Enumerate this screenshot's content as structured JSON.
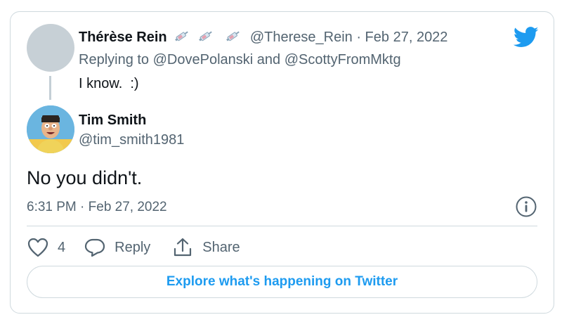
{
  "parent_tweet": {
    "author_name": "Thérèse Rein",
    "emojis": [
      "syringe-emoji",
      "syringe-emoji",
      "syringe-emoji"
    ],
    "handle_time": "@Therese_Rein · Feb 27, 2022",
    "replying_prefix": "Replying to",
    "replying_to_1": "@DovePolanski",
    "replying_and": "and",
    "replying_to_2": "@ScottyFromMktg",
    "text": "I know.  :)"
  },
  "main_tweet": {
    "author_name": "Tim Smith",
    "handle": "@tim_smith1981",
    "text": "No you didn't.",
    "timestamp": "6:31 PM · Feb 27, 2022"
  },
  "actions": {
    "like_count": "4",
    "reply_label": "Reply",
    "share_label": "Share"
  },
  "explore_button": "Explore what's happening on Twitter",
  "colors": {
    "twitter_blue": "#1d9bf0",
    "secondary_text": "#536471",
    "border": "#cfd9de"
  }
}
